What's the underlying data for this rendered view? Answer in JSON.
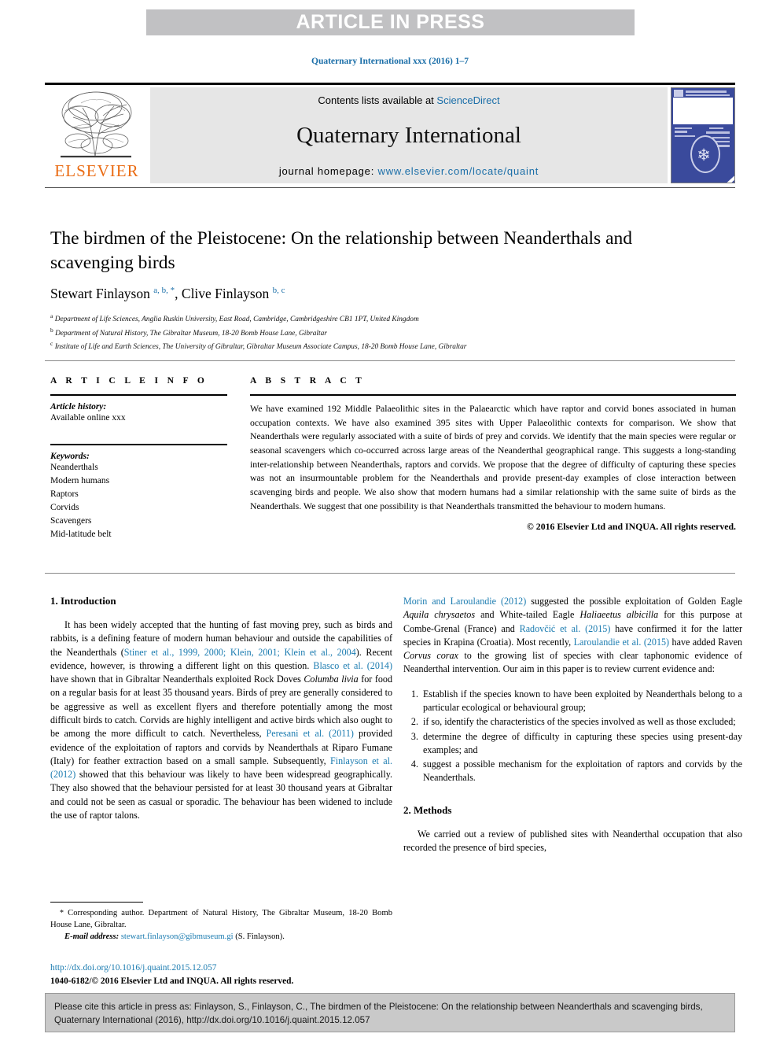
{
  "banner": {
    "text": "ARTICLE IN PRESS"
  },
  "journal_ref": "Quaternary International xxx (2016) 1–7",
  "masthead": {
    "contents_prefix": "Contents lists available at ",
    "sciencedirect": "ScienceDirect",
    "journal_title": "Quaternary International",
    "homepage_label": "journal homepage: ",
    "homepage_url": "www.elsevier.com/locate/quaint",
    "publisher": "ELSEVIER"
  },
  "article": {
    "title": "The birdmen of the Pleistocene: On the relationship between Neanderthals and scavenging birds",
    "authors_part1": "Stewart Finlayson ",
    "authors_marks1": "a, b, *",
    "authors_part2": ", Clive Finlayson ",
    "authors_marks2": "b, c",
    "affiliations": [
      {
        "mark": "a",
        "text": "Department of Life Sciences, Anglia Ruskin University, East Road, Cambridge, Cambridgeshire CB1 1PT, United Kingdom"
      },
      {
        "mark": "b",
        "text": "Department of Natural History, The Gibraltar Museum, 18-20 Bomb House Lane, Gibraltar"
      },
      {
        "mark": "c",
        "text": "Institute of Life and Earth Sciences, The University of Gibraltar, Gibraltar Museum Associate Campus, 18-20 Bomb House Lane, Gibraltar"
      }
    ]
  },
  "info": {
    "heading": "A R T I C L E   I N F O",
    "history_label": "Article history:",
    "history_value": "Available online xxx",
    "keywords_label": "Keywords:",
    "keywords": [
      "Neanderthals",
      "Modern humans",
      "Raptors",
      "Corvids",
      "Scavengers",
      "Mid-latitude belt"
    ]
  },
  "abstract": {
    "heading": "A B S T R A C T",
    "body": "We have examined 192 Middle Palaeolithic sites in the Palaearctic which have raptor and corvid bones associated in human occupation contexts. We have also examined 395 sites with Upper Palaeolithic contexts for comparison. We show that Neanderthals were regularly associated with a suite of birds of prey and corvids. We identify that the main species were regular or seasonal scavengers which co-occurred across large areas of the Neanderthal geographical range. This suggests a long-standing inter-relationship between Neanderthals, raptors and corvids. We propose that the degree of difficulty of capturing these species was not an insurmountable problem for the Neanderthals and provide present-day examples of close interaction between scavenging birds and people. We also show that modern humans had a similar relationship with the same suite of birds as the Neanderthals. We suggest that one possibility is that Neanderthals transmitted the behaviour to modern humans.",
    "copyright": "© 2016 Elsevier Ltd and INQUA. All rights reserved."
  },
  "sections": {
    "intro_heading": "1. Introduction",
    "methods_heading": "2. Methods",
    "methods_para": "We carried out a review of published sites with Neanderthal occupation that also recorded the presence of bird species,"
  },
  "intro": {
    "p1_a": "It has been widely accepted that the hunting of fast moving prey, such as birds and rabbits, is a defining feature of modern human behaviour and outside the capabilities of the Neanderthals (",
    "p1_ref1": "Stiner et al., 1999, 2000; Klein, 2001; Klein et al., 2004",
    "p1_b": "). Recent evidence, however, is throwing a different light on this question. ",
    "p1_ref2": "Blasco et al. (2014)",
    "p1_c": " have shown that in Gibraltar Neanderthals exploited Rock Doves ",
    "p1_sp1": "Columba livia",
    "p1_d": " for food on a regular basis for at least 35 thousand years. Birds of prey are generally considered to be aggressive as well as excellent flyers and therefore potentially among the most difficult birds to catch. Corvids are highly intelligent and active birds which also ought to be among the more difficult to catch. Nevertheless, ",
    "p1_ref3": "Peresani et al. (2011)",
    "p1_e": " provided evidence of the exploitation of raptors and corvids by Neanderthals at Riparo Fumane (Italy) for feather extraction based on a small sample. Subsequently, ",
    "p1_ref4": "Finlayson et al. (2012)",
    "p1_f": " showed that this behaviour was likely to have been widespread geographically. They also showed that the behaviour persisted for at least 30 thousand years at Gibraltar and could not be seen as casual or sporadic. The behaviour has been widened to include the use of raptor talons. ",
    "p1_ref5": "Morin and Laroulandie (2012)",
    "p1_g": " suggested the possible exploitation of Golden Eagle ",
    "p1_sp2": "Aquila chrysaetos",
    "p1_h": " and White-tailed Eagle ",
    "p1_sp3": "Haliaeetus albicilla",
    "p1_i": " for this purpose at Combe-Grenal (France) and ",
    "p1_ref6": "Radovčić et al. (2015)",
    "p1_j": " have confirmed it for the latter species in Krapina (Croatia). Most recently, ",
    "p1_ref7": "Laroulandie et al. (2015)",
    "p1_k": " have added Raven ",
    "p1_sp4": "Corvus corax",
    "p1_l": " to the growing list of species with clear taphonomic evidence of Neanderthal intervention. Our aim in this paper is to review current evidence and:",
    "aims": [
      "Establish if the species known to have been exploited by Neanderthals belong to a particular ecological or behavioural group;",
      "if so, identify the characteristics of the species involved as well as those excluded;",
      "determine the degree of difficulty in capturing these species using present-day examples; and",
      "suggest a possible mechanism for the exploitation of raptors and corvids by the Neanderthals."
    ]
  },
  "footnote": {
    "star": "*",
    "corresponding": " Corresponding author. Department of Natural History, The Gibraltar Museum, 18-20 Bomb House Lane, Gibraltar.",
    "email_label": "E-mail address:",
    "email": "stewart.finlayson@gibmuseum.gi",
    "email_suffix": " (S. Finlayson).",
    "doi": "http://dx.doi.org/10.1016/j.quaint.2015.12.057",
    "issn": "1040-6182/© 2016 Elsevier Ltd and INQUA. All rights reserved."
  },
  "cite_box": {
    "text": "Please cite this article in press as: Finlayson, S., Finlayson, C., The birdmen of the Pleistocene: On the relationship between Neanderthals and scavenging birds, Quaternary International (2016), http://dx.doi.org/10.1016/j.quaint.2015.12.057"
  },
  "colors": {
    "link": "#1a7bb0",
    "banner_bg": "#c1c1c3",
    "panel_bg": "#e6e6e6",
    "elsevier_orange": "#ea6c14",
    "cover_blue": "#3a4a9c",
    "cite_bg": "#c9c9c9"
  }
}
